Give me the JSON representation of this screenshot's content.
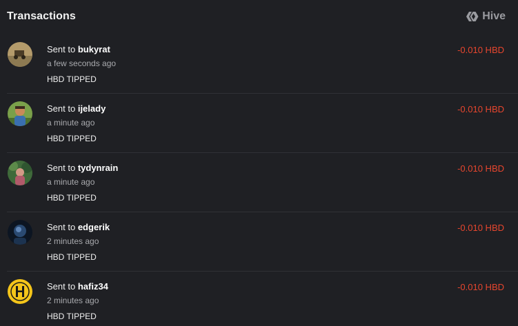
{
  "header": {
    "title": "Transactions",
    "brand": "Hive",
    "brand_icon": "hive-logo-icon"
  },
  "colors": {
    "background": "#1f2024",
    "amount_negative": "#e8462e",
    "muted_text": "#a9aaae"
  },
  "transactions": [
    {
      "prefix": "Sent to",
      "user": "bukyrat",
      "time": "a few seconds ago",
      "memo": "HBD TIPPED",
      "amount": "-0.010 HBD",
      "avatar_icon": "avatar-bukyrat"
    },
    {
      "prefix": "Sent to",
      "user": "ijelady",
      "time": "a minute ago",
      "memo": "HBD TIPPED",
      "amount": "-0.010 HBD",
      "avatar_icon": "avatar-ijelady"
    },
    {
      "prefix": "Sent to",
      "user": "tydynrain",
      "time": "a minute ago",
      "memo": "HBD TIPPED",
      "amount": "-0.010 HBD",
      "avatar_icon": "avatar-tydynrain"
    },
    {
      "prefix": "Sent to",
      "user": "edgerik",
      "time": "2 minutes ago",
      "memo": "HBD TIPPED",
      "amount": "-0.010 HBD",
      "avatar_icon": "avatar-edgerik"
    },
    {
      "prefix": "Sent to",
      "user": "hafiz34",
      "time": "2 minutes ago",
      "memo": "HBD TIPPED",
      "amount": "-0.010 HBD",
      "avatar_icon": "avatar-hafiz34"
    }
  ]
}
